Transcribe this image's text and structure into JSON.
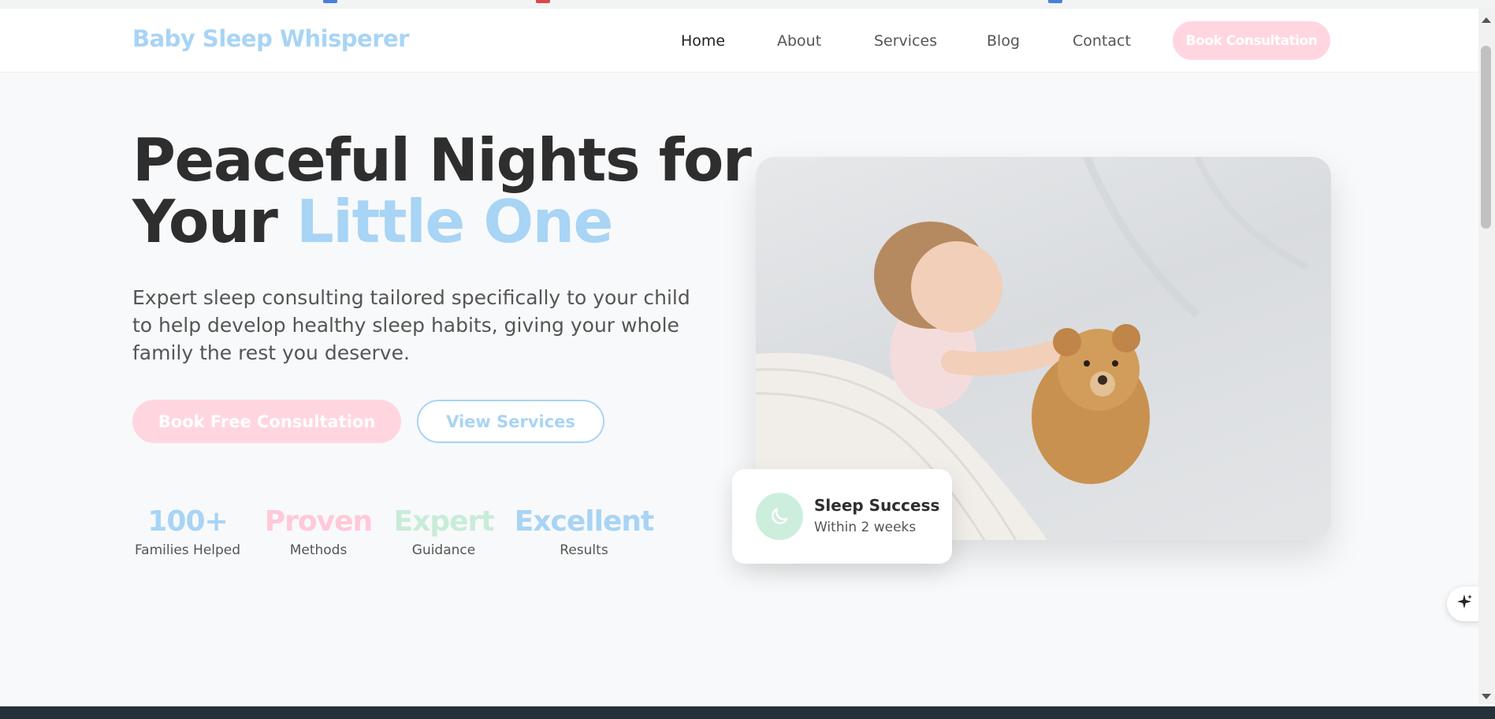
{
  "brand": "Baby Sleep Whisperer",
  "nav": {
    "items": [
      "Home",
      "About",
      "Services",
      "Blog",
      "Contact"
    ],
    "active": "Home",
    "cta": "Book Consultation"
  },
  "hero": {
    "title_line1": "Peaceful Nights for",
    "title_line2_prefix": "Your ",
    "title_line2_accent": "Little One",
    "subtitle": "Expert sleep consulting tailored specifically to your child to help develop healthy sleep habits, giving your whole family the rest you deserve.",
    "primary_button": "Book Free Consultation",
    "secondary_button": "View Services"
  },
  "stats": [
    {
      "value": "100+",
      "label": "Families Helped",
      "color": "#a8d4f5"
    },
    {
      "value": "Proven",
      "label": "Methods",
      "color": "#ffc9d8"
    },
    {
      "value": "Expert",
      "label": "Guidance",
      "color": "#c8ecd8"
    },
    {
      "value": "Excellent",
      "label": "Results",
      "color": "#a8d4f5"
    }
  ],
  "success_card": {
    "title": "Sleep Success",
    "subtitle": "Within 2 weeks",
    "icon": "moon-icon"
  },
  "colors": {
    "accent_blue": "#a8d4f5",
    "accent_pink": "#ffd6e0",
    "accent_mint": "#cdeedd",
    "text_dark": "#2e2e2e"
  }
}
